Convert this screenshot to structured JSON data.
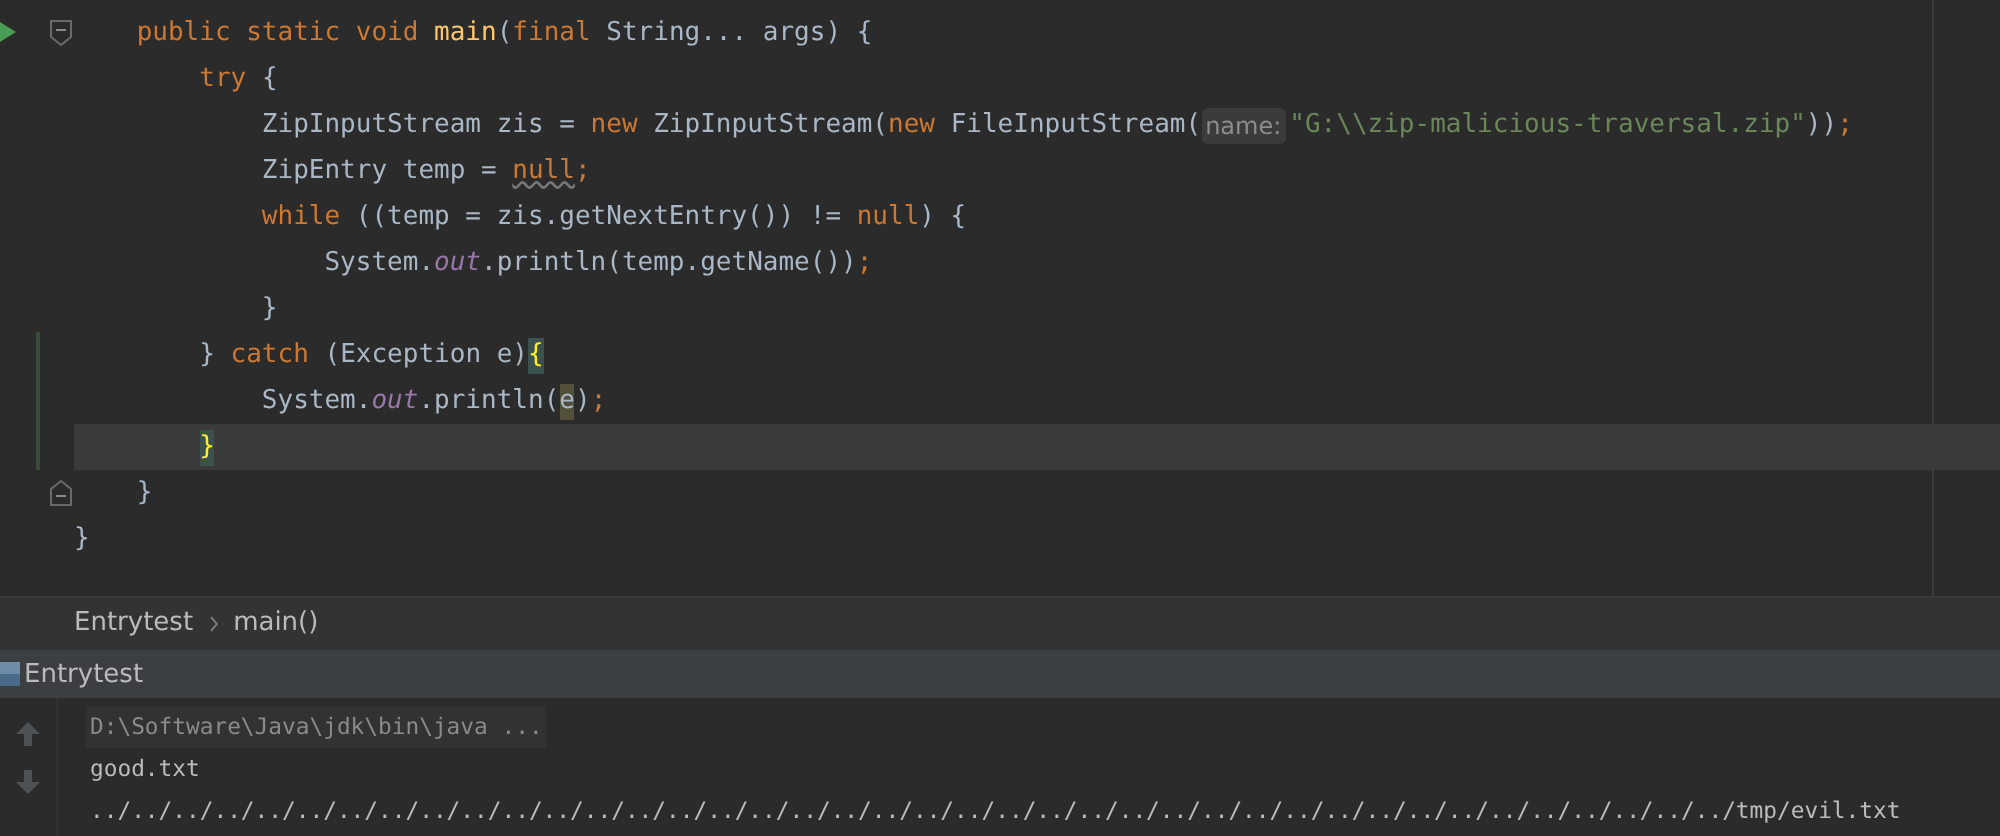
{
  "editor": {
    "lines": [
      {
        "run_marker": true,
        "fold_start": true,
        "fold_end": false,
        "changed": false,
        "current": false,
        "tokens": [
          {
            "text": "    public static void ",
            "kind": "keyword"
          },
          {
            "text": "main",
            "kind": "method"
          },
          {
            "text": "(",
            "kind": "plain"
          },
          {
            "text": "final ",
            "kind": "keyword"
          },
          {
            "text": "String... args) {",
            "kind": "plain"
          }
        ]
      },
      {
        "run_marker": false,
        "fold_start": false,
        "fold_end": false,
        "changed": false,
        "current": false,
        "tokens": [
          {
            "text": "        try ",
            "kind": "keyword"
          },
          {
            "text": "{",
            "kind": "plain"
          }
        ]
      },
      {
        "run_marker": false,
        "fold_start": false,
        "fold_end": false,
        "changed": false,
        "current": false,
        "tokens": [
          {
            "text": "            ZipInputStream zis = ",
            "kind": "plain"
          },
          {
            "text": "new ",
            "kind": "keyword"
          },
          {
            "text": "ZipInputStream(",
            "kind": "plain"
          },
          {
            "text": "new ",
            "kind": "keyword"
          },
          {
            "text": "FileInputStream(",
            "kind": "plain"
          },
          {
            "text": "name:",
            "kind": "hint"
          },
          {
            "text": "\"G:\\\\zip-malicious-traversal.zip\"",
            "kind": "string"
          },
          {
            "text": "))",
            "kind": "plain"
          },
          {
            "text": ";",
            "kind": "keyword"
          }
        ]
      },
      {
        "run_marker": false,
        "fold_start": false,
        "fold_end": false,
        "changed": false,
        "current": false,
        "tokens": [
          {
            "text": "            ZipEntry temp = ",
            "kind": "plain"
          },
          {
            "text": "null",
            "kind": "warning"
          },
          {
            "text": ";",
            "kind": "keyword"
          }
        ]
      },
      {
        "run_marker": false,
        "fold_start": false,
        "fold_end": false,
        "changed": false,
        "current": false,
        "tokens": [
          {
            "text": "            while ",
            "kind": "keyword"
          },
          {
            "text": "((temp = zis.getNextEntry()) != ",
            "kind": "plain"
          },
          {
            "text": "null",
            "kind": "keyword"
          },
          {
            "text": ") {",
            "kind": "plain"
          }
        ]
      },
      {
        "run_marker": false,
        "fold_start": false,
        "fold_end": false,
        "changed": false,
        "current": false,
        "tokens": [
          {
            "text": "                System.",
            "kind": "plain"
          },
          {
            "text": "out",
            "kind": "field"
          },
          {
            "text": ".println(temp.getName())",
            "kind": "plain"
          },
          {
            "text": ";",
            "kind": "keyword"
          }
        ]
      },
      {
        "run_marker": false,
        "fold_start": false,
        "fold_end": false,
        "changed": false,
        "current": false,
        "tokens": [
          {
            "text": "            }",
            "kind": "plain"
          }
        ]
      },
      {
        "run_marker": false,
        "fold_start": false,
        "fold_end": false,
        "changed": true,
        "current": false,
        "tokens": [
          {
            "text": "        } ",
            "kind": "plain"
          },
          {
            "text": "catch ",
            "kind": "keyword"
          },
          {
            "text": "(Exception e)",
            "kind": "plain"
          },
          {
            "text": "{",
            "kind": "brace-match"
          }
        ]
      },
      {
        "run_marker": false,
        "fold_start": false,
        "fold_end": false,
        "changed": true,
        "current": false,
        "tokens": [
          {
            "text": "            System.",
            "kind": "plain"
          },
          {
            "text": "out",
            "kind": "field"
          },
          {
            "text": ".println(",
            "kind": "plain"
          },
          {
            "text": "e",
            "kind": "usage"
          },
          {
            "text": ")",
            "kind": "plain"
          },
          {
            "text": ";",
            "kind": "keyword"
          }
        ]
      },
      {
        "run_marker": false,
        "fold_start": false,
        "fold_end": false,
        "changed": true,
        "current": true,
        "tokens": [
          {
            "text": "        }",
            "kind": "brace-match"
          }
        ]
      },
      {
        "run_marker": false,
        "fold_start": false,
        "fold_end": true,
        "changed": false,
        "current": false,
        "tokens": [
          {
            "text": "    }",
            "kind": "plain"
          }
        ]
      },
      {
        "run_marker": false,
        "fold_start": false,
        "fold_end": false,
        "changed": false,
        "current": false,
        "tokens": [
          {
            "text": "}",
            "kind": "plain"
          }
        ]
      }
    ]
  },
  "breadcrumbs": [
    "Entrytest",
    "main()"
  ],
  "run_panel": {
    "title": "Entrytest",
    "output": [
      {
        "text": "D:\\Software\\Java\\jdk\\bin\\java ...",
        "kind": "command"
      },
      {
        "text": "good.txt",
        "kind": "stdout"
      },
      {
        "text": "../../../../../../../../../../../../../../../../../../../../../../../../../../../../../../../../../../../../../../../../tmp/evil.txt",
        "kind": "stdout"
      }
    ]
  }
}
